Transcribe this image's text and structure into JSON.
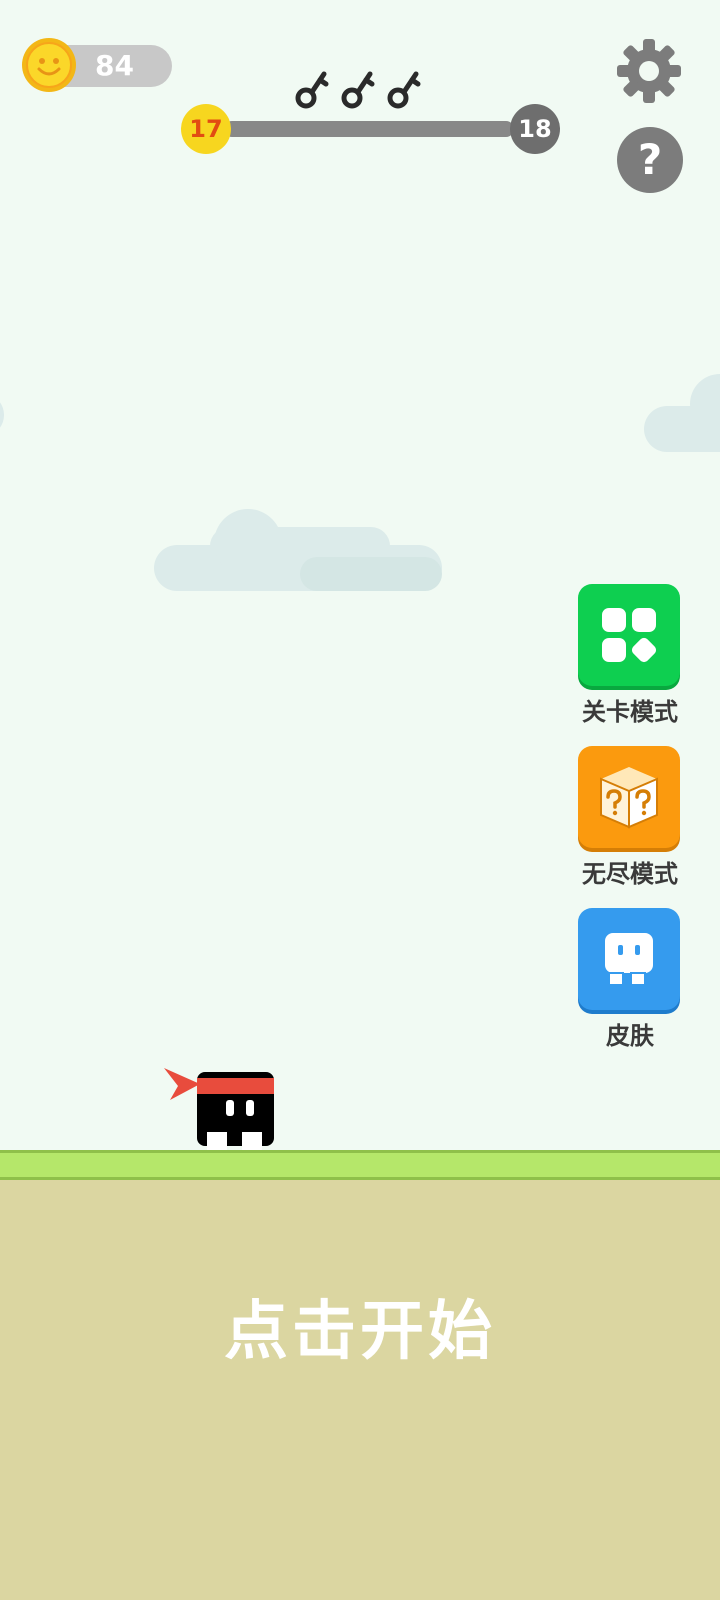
{
  "hud": {
    "coins": "84",
    "current_level": "17",
    "next_level": "18",
    "level_progress": 0,
    "keys_collected": 3,
    "settings_icon": "gear-icon",
    "help_icon": "question-icon",
    "help_glyph": "?"
  },
  "side_menu": {
    "level_mode_label": "关卡模式",
    "level_mode_icon": "grid-icon",
    "endless_mode_label": "无尽模式",
    "endless_mode_icon": "mystery-box-icon",
    "skin_label": "皮肤",
    "skin_icon": "character-icon"
  },
  "ground": {
    "start_prompt": "点击开始"
  },
  "colors": {
    "sky": "#f1faf3",
    "grass": "#b5e76a",
    "dirt": "#dbd6a1",
    "level_mode": "#0ecf50",
    "endless_mode": "#fb9a0e",
    "skin": "#359bee",
    "coin": "#f7d61f",
    "headband": "#e84c3d"
  }
}
